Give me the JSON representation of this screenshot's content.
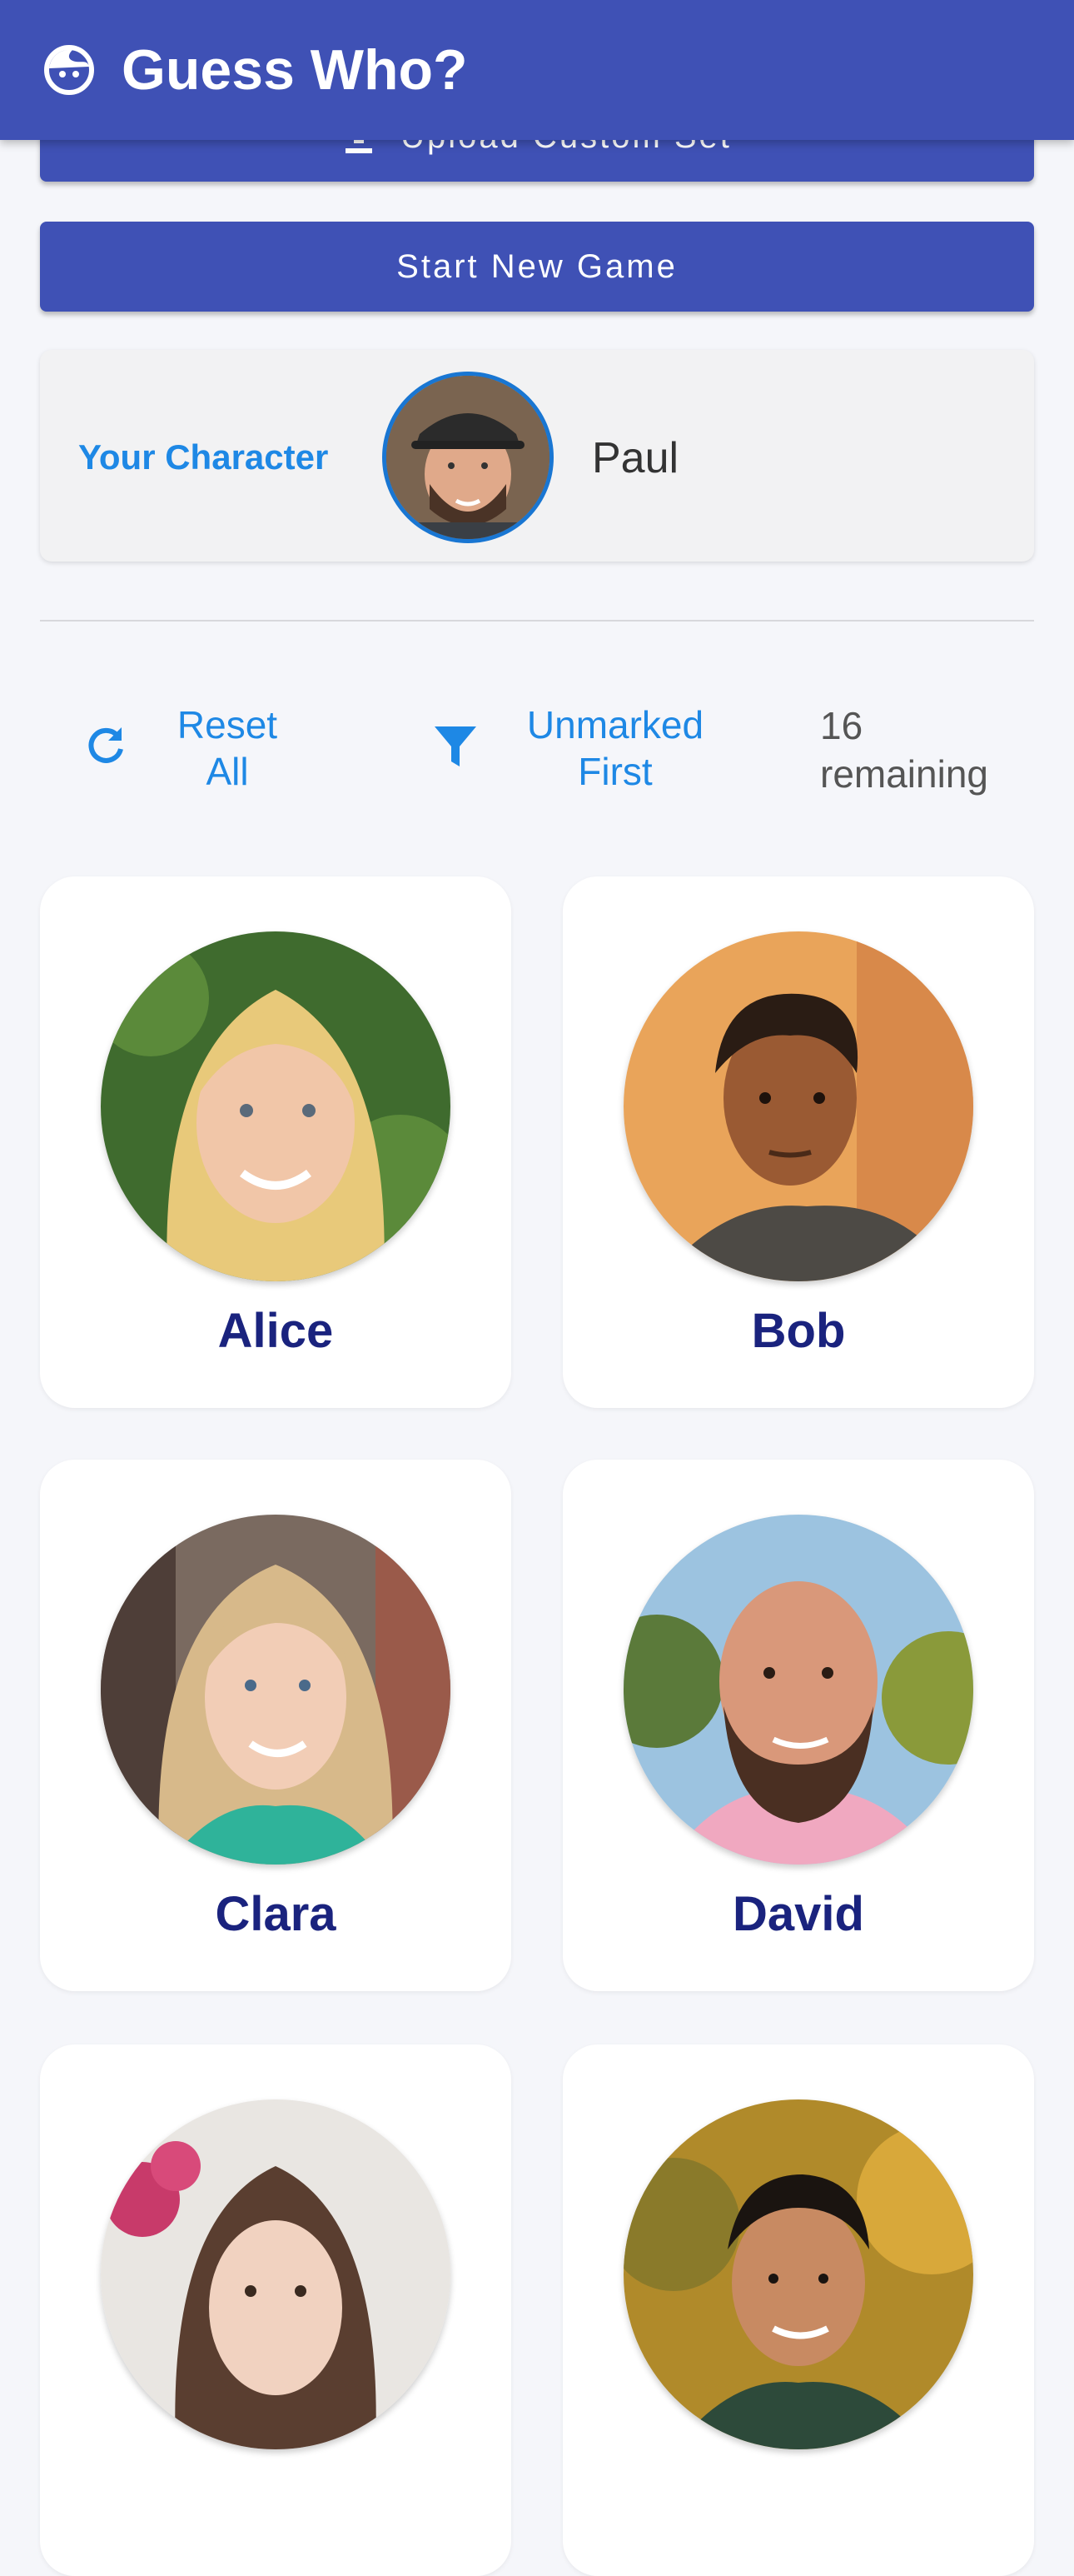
{
  "app": {
    "title": "Guess Who?",
    "logo_icon": "face-icon"
  },
  "buttons": {
    "upload_label": "Upload Custom Set",
    "start_label": "Start New Game"
  },
  "your_character": {
    "label": "Your Character",
    "name": "Paul"
  },
  "toolbar": {
    "reset_label": "Reset All",
    "reset_icon": "refresh-icon",
    "filter_label": "Unmarked First",
    "filter_icon": "filter-icon",
    "remaining_count": "16",
    "remaining_label": "remaining"
  },
  "characters": [
    {
      "name": "Alice"
    },
    {
      "name": "Bob"
    },
    {
      "name": "Clara"
    },
    {
      "name": "David"
    },
    {
      "name": ""
    },
    {
      "name": ""
    }
  ],
  "colors": {
    "primary": "#3f51b5",
    "accent": "#1e88e5",
    "name_text": "#1a237e",
    "background": "#f5f6fa"
  }
}
